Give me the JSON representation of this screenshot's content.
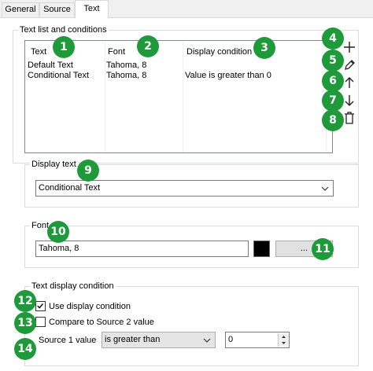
{
  "tabs": [
    {
      "label": "General"
    },
    {
      "label": "Source"
    },
    {
      "label": "Text"
    }
  ],
  "text_list": {
    "group_label": "Text list and conditions",
    "columns": [
      "Text",
      "Font",
      "Display condition"
    ],
    "rows": [
      {
        "text": "Default Text",
        "font": "Tahoma, 8",
        "condition": ""
      },
      {
        "text": "Conditional Text",
        "font": "Tahoma, 8",
        "condition": "Value is greater than 0"
      }
    ],
    "tools": [
      "add-icon",
      "edit-icon",
      "move-up-icon",
      "move-down-icon",
      "delete-icon"
    ]
  },
  "display_text": {
    "group_label": "Display text",
    "selected": "Conditional Text"
  },
  "font": {
    "group_label": "Font",
    "value": "Tahoma, 8",
    "color": "#000000",
    "browse_label": "..."
  },
  "condition": {
    "group_label": "Text display condition",
    "use_display_condition_label": "Use display condition",
    "use_display_condition_checked": true,
    "compare_to_source2_label": "Compare to Source 2 value",
    "compare_to_source2_checked": false,
    "source1_label": "Source 1 value",
    "operator": "is greater than",
    "value": "0"
  },
  "badges": [
    "1",
    "2",
    "3",
    "4",
    "5",
    "6",
    "7",
    "8",
    "9",
    "10",
    "11",
    "12",
    "13",
    "14"
  ],
  "colors": {
    "badge": "#1f9a3a"
  }
}
